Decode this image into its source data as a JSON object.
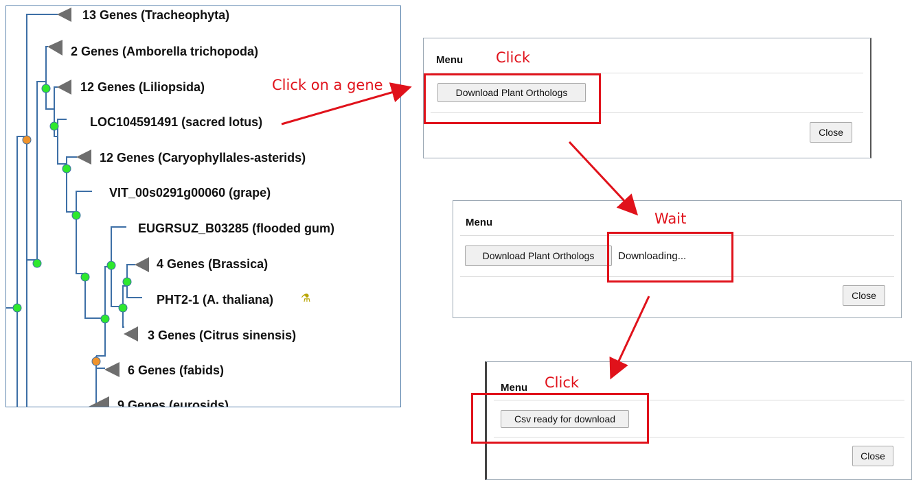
{
  "tree": {
    "nodes": [
      {
        "label": "13 Genes (Tracheophyta)",
        "collapsed": true
      },
      {
        "label": "2 Genes (Amborella trichopoda)",
        "collapsed": true
      },
      {
        "label": "12 Genes (Liliopsida)",
        "collapsed": true
      },
      {
        "label": "LOC104591491 (sacred lotus)",
        "collapsed": false
      },
      {
        "label": "12 Genes (Caryophyllales-asterids)",
        "collapsed": true
      },
      {
        "label": "VIT_00s0291g00060 (grape)",
        "collapsed": false
      },
      {
        "label": "EUGRSUZ_B03285 (flooded gum)",
        "collapsed": false
      },
      {
        "label": "4 Genes (Brassica)",
        "collapsed": true
      },
      {
        "label": "PHT2-1 (A. thaliana)",
        "collapsed": false,
        "icon": "flask-icon"
      },
      {
        "label": "3 Genes (Citrus sinensis)",
        "collapsed": true
      },
      {
        "label": "6 Genes (fabids)",
        "collapsed": true
      },
      {
        "label": "9 Genes (eurosids)",
        "collapsed": true
      }
    ],
    "colors": {
      "branch": "#3d6fa6",
      "node_speciation": "#2ee82e",
      "node_duplication": "#f0932b",
      "collapsed": "#6e6e6e"
    }
  },
  "dialogs": [
    {
      "title": "Menu",
      "button": "Download Plant Orthologs",
      "status": "",
      "close": "Close"
    },
    {
      "title": "Menu",
      "button": "Download Plant Orthologs",
      "status": "Downloading...",
      "close": "Close"
    },
    {
      "title": "Menu",
      "button": "Csv ready for download",
      "status": "",
      "close": "Close"
    }
  ],
  "annotations": {
    "click_gene": "Click on a gene",
    "click1": "Click",
    "wait": "Wait",
    "click2": "Click",
    "color": "#e0121b"
  }
}
